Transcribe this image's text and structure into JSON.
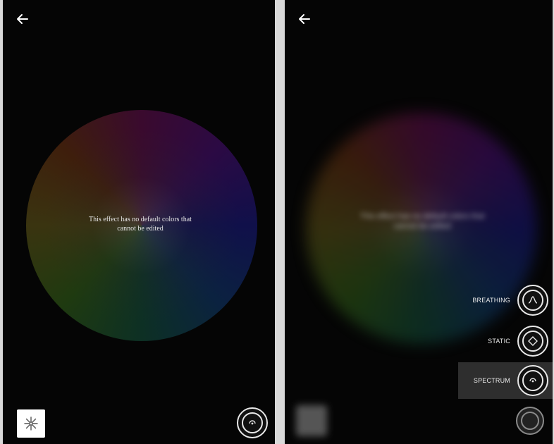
{
  "left_screen": {
    "back_icon": "arrow-left-icon",
    "wheel_message_line1": "This effect has no default colors that",
    "wheel_message_line2": "cannot be edited",
    "sparkle_icon": "sparkle-icon",
    "effect_button_icon": "spectrum-icon"
  },
  "right_screen": {
    "back_icon": "arrow-left-icon",
    "blurred_message_line1": "This effect has no default colors that",
    "blurred_message_line2": "cannot be edited",
    "effects_menu": [
      {
        "label": "BREATHING",
        "icon": "breathing-icon",
        "selected": false
      },
      {
        "label": "STATIC",
        "icon": "static-icon",
        "selected": false
      },
      {
        "label": "SPECTRUM",
        "icon": "spectrum-icon",
        "selected": true
      }
    ],
    "fab_icon": "spectrum-icon"
  },
  "colors": {
    "background": "#050505",
    "foreground": "#e8e8e8",
    "selected_row": "#2e2e2e"
  }
}
